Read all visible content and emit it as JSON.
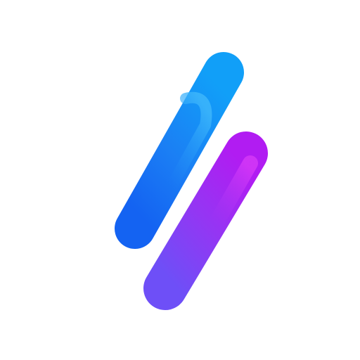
{
  "logo": {
    "icon_name": "seven-stripes-logo-icon",
    "background": "#ffffff",
    "colors": {
      "blue_light": "#12A8FA",
      "blue_mid": "#1E86F6",
      "blue_dark": "#1563F2",
      "purple_light": "#9B5BF5",
      "purple_mid": "#8A34F0",
      "magenta": "#C620F4",
      "violet": "#6F4DF7"
    }
  }
}
